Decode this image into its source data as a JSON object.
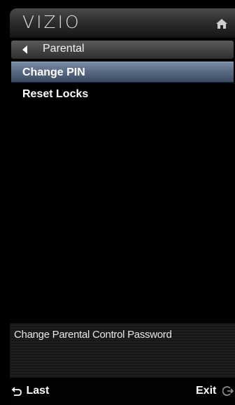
{
  "header": {
    "brand": "VIZIO",
    "home_icon": "home-icon"
  },
  "breadcrumb": {
    "back_icon": "left-arrow-icon",
    "label": "Parental"
  },
  "menu": {
    "items": [
      {
        "label": "Change PIN",
        "selected": true
      },
      {
        "label": "Reset Locks",
        "selected": false
      }
    ]
  },
  "description": {
    "text": "Change Parental Control Password"
  },
  "footer": {
    "last_label": "Last",
    "last_icon": "return-arrow-icon",
    "exit_label": "Exit",
    "exit_icon": "exit-icon"
  },
  "colors": {
    "selected_highlight": "#5b6c85",
    "background": "#000000"
  }
}
